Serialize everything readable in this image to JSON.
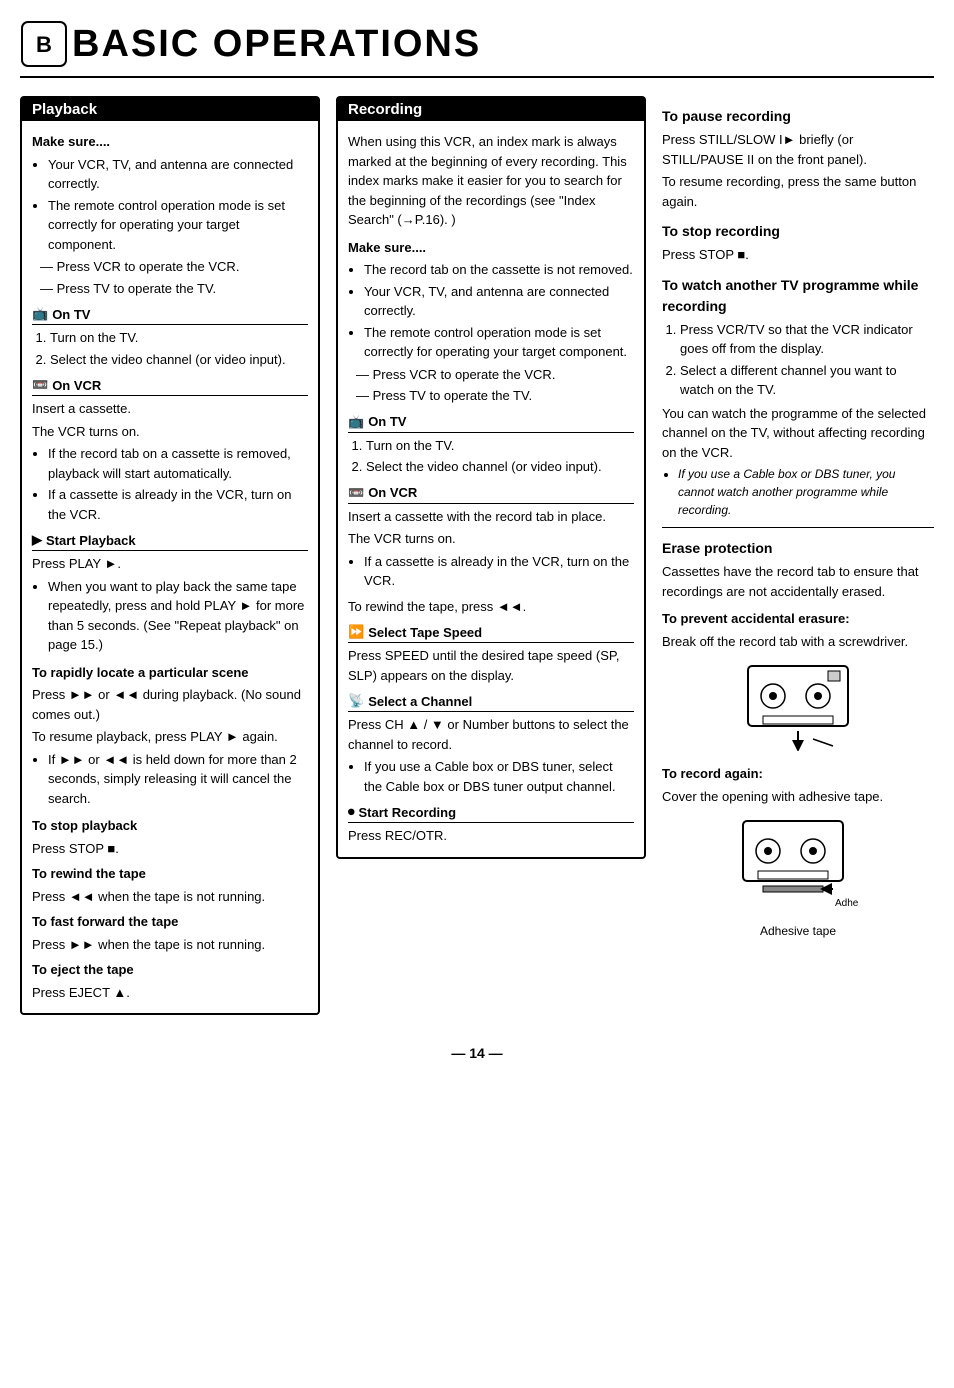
{
  "header": {
    "title": "BASIC OPERATIONS",
    "logo_alt": "logo"
  },
  "playback": {
    "section_title": "Playback",
    "make_sure_label": "Make sure....",
    "make_sure_items": [
      "Your VCR, TV, and antenna are connected correctly.",
      "The remote control operation mode is set correctly for operating your target component."
    ],
    "dash_items": [
      "Press VCR to operate the VCR.",
      "Press TV to operate the TV."
    ],
    "on_tv_heading": "On TV",
    "on_tv_steps": [
      "Turn on the TV.",
      "Select the video channel (or video input)."
    ],
    "on_vcr_heading": "On VCR",
    "on_vcr_intro": "Insert a cassette.",
    "on_vcr_line2": "The VCR turns on.",
    "on_vcr_bullets": [
      "If the record tab on a cassette is removed, playback will start automatically.",
      "If a cassette is already in the VCR, turn on the VCR."
    ],
    "start_playback_heading": "Start Playback",
    "start_playback_line1": "Press PLAY ►.",
    "start_playback_bullets": [
      "When you want to play back the same tape repeatedly, press and hold PLAY ► for more than 5 seconds. (See \"Repeat playback\" on page 15.)"
    ],
    "rapidly_heading": "To rapidly locate a particular scene",
    "rapidly_line1": "Press ►► or ◄◄ during playback. (No sound comes out.)",
    "rapidly_line2": "To resume playback, press PLAY ► again.",
    "rapidly_bullets": [
      "If ►► or ◄◄ is held down for more than 2 seconds, simply releasing it will cancel the search."
    ],
    "stop_playback_heading": "To stop playback",
    "stop_playback_line": "Press STOP ■.",
    "rewind_heading": "To rewind the tape",
    "rewind_line": "Press ◄◄ when the tape is not running.",
    "fast_forward_heading": "To fast forward the tape",
    "fast_forward_line": "Press ►► when the tape is not running.",
    "eject_heading": "To eject the tape",
    "eject_line": "Press EJECT ▲."
  },
  "recording": {
    "section_title": "Recording",
    "intro": "When using this VCR, an index mark is always marked at the beginning of every recording. This index marks make it easier for you to search for the beginning of the recordings (see \"Index Search\" (→P.16). )",
    "make_sure_label": "Make sure....",
    "make_sure_bullets": [
      "The record tab on the cassette is not removed.",
      "Your VCR, TV, and antenna are connected correctly.",
      "The remote control operation mode is set correctly for operating your target component."
    ],
    "dash_items": [
      "Press VCR to operate the VCR.",
      "Press TV to operate the TV."
    ],
    "on_tv_heading": "On TV",
    "on_tv_steps": [
      "Turn on the TV.",
      "Select the video channel (or video input)."
    ],
    "on_vcr_heading": "On VCR",
    "on_vcr_intro": "Insert a cassette with the record tab in place.",
    "on_vcr_line2": "The VCR turns on.",
    "on_vcr_bullets": [
      "If a cassette is already in the VCR, turn on the VCR."
    ],
    "rewind_label": "To rewind the tape, press ◄◄.",
    "select_tape_heading": "Select Tape Speed",
    "select_tape_line": "Press SPEED until the desired tape speed (SP, SLP) appears on the display.",
    "select_channel_heading": "Select a Channel",
    "select_channel_line": "Press CH ▲ / ▼ or Number buttons to select the channel to record.",
    "select_channel_bullets": [
      "If you use a Cable box or DBS tuner, select the Cable box or DBS tuner output channel."
    ],
    "start_recording_heading": "Start Recording",
    "start_recording_line": "Press REC/OTR."
  },
  "right_col": {
    "pause_recording_heading": "To pause recording",
    "pause_recording_line1": "Press STILL/SLOW I► briefly (or STILL/PAUSE II on the front panel).",
    "pause_recording_line2": "To resume recording, press the same button again.",
    "stop_recording_heading": "To stop recording",
    "stop_recording_line": "Press STOP ■.",
    "watch_tv_heading": "To watch another TV programme while recording",
    "watch_tv_steps": [
      "Press VCR/TV so that the VCR indicator goes off from the display.",
      "Select a different channel you want to watch on the TV."
    ],
    "watch_tv_line": "You can watch the programme of the selected channel on the TV, without affecting recording on the VCR.",
    "watch_tv_bullet": "If you use a Cable box or DBS tuner, you cannot watch another programme while recording.",
    "erase_heading": "Erase protection",
    "erase_line": "Cassettes have the record tab to ensure that recordings are not accidentally erased.",
    "prevent_heading": "To prevent accidental erasure:",
    "prevent_line": "Break off the record tab with a screwdriver.",
    "record_again_heading": "To record again:",
    "record_again_line": "Cover the opening with adhesive tape.",
    "adhesive_tape_label": "Adhesive tape"
  },
  "footer": {
    "page_number": "— 14 —"
  }
}
